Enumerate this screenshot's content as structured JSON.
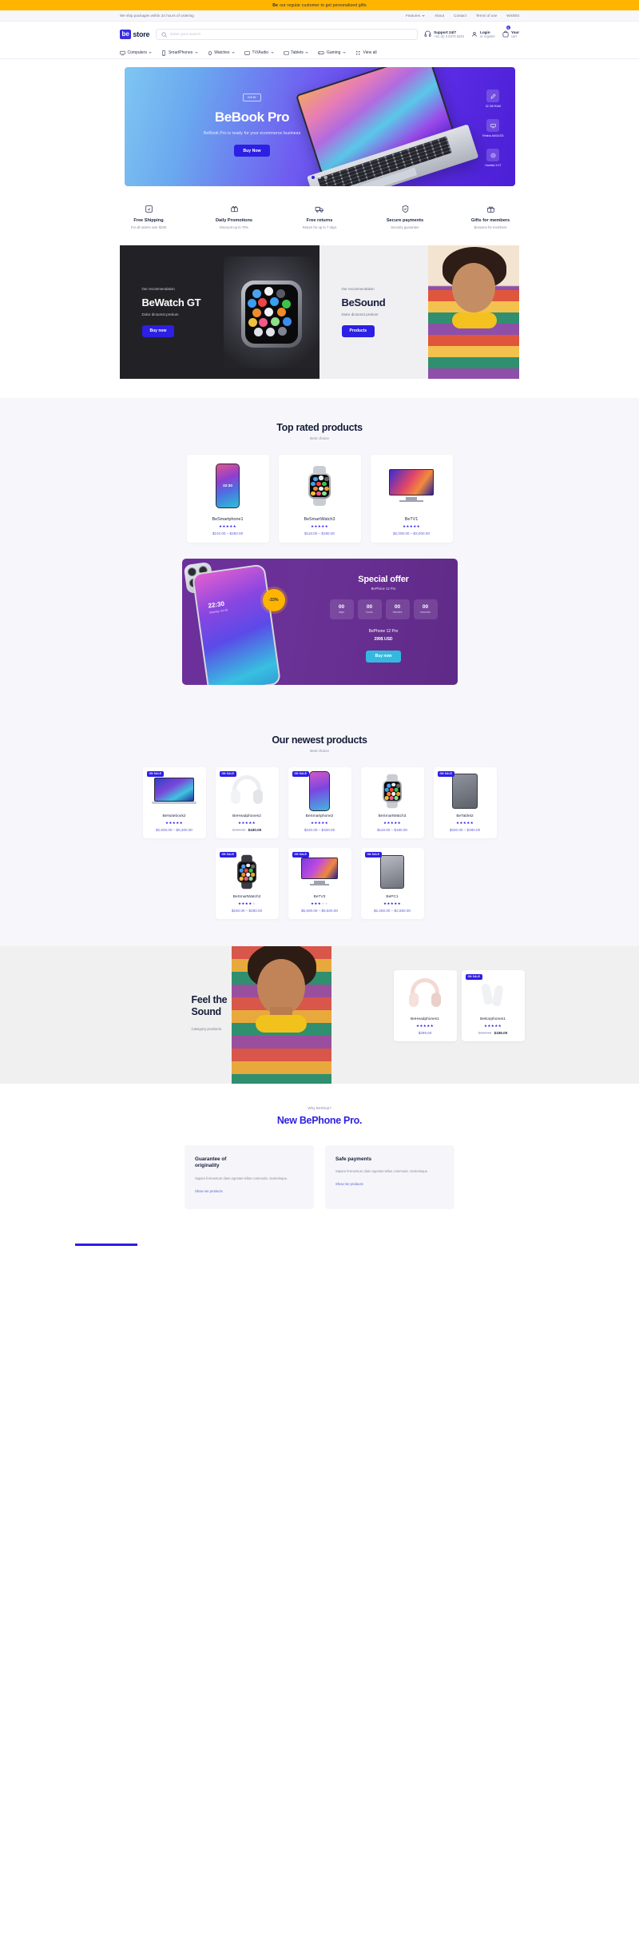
{
  "promo_bar": {
    "bold": "Be",
    "text": "our regular customer to get personalized gifts"
  },
  "util_bar": {
    "shipping_note": "We ship packages within 24 hours of ordering",
    "links": [
      "Features",
      "About",
      "Contact",
      "Terms of use",
      "Wishlist"
    ]
  },
  "header": {
    "logo_mark": "be",
    "logo_text": "store",
    "search_placeholder": "Enter your search",
    "search_value": "",
    "support_title": "Support 24/7",
    "support_phone": "+61 (0) 3 8376 6284",
    "login_title": "Login",
    "login_sub": "or register",
    "cart_title": "Your",
    "cart_sub": "cart",
    "cart_count": "0"
  },
  "categories": [
    {
      "label": "Computers",
      "icon": "monitor-icon"
    },
    {
      "label": "SmartPhones",
      "icon": "phone-icon"
    },
    {
      "label": "Watches",
      "icon": "watch-icon"
    },
    {
      "label": "TV/Audio",
      "icon": "tv-icon"
    },
    {
      "label": "Tablets",
      "icon": "tablet-icon"
    },
    {
      "label": "Gaming",
      "icon": "gamepad-icon"
    },
    {
      "label": "View all",
      "icon": "grid-icon"
    }
  ],
  "hero": {
    "badge": "NEW",
    "title": "BeBook Pro",
    "subtitle": "BeBook Pro is ready for your ecommerce business",
    "cta": "Buy Now",
    "specs": [
      {
        "label": "32 GB RAM",
        "icon": "pen-icon"
      },
      {
        "label": "Retina AMOLED",
        "icon": "display-icon"
      },
      {
        "label": "Hardisk 3.07",
        "icon": "disk-icon"
      }
    ],
    "slides": 3,
    "active_slide": 1
  },
  "features": [
    {
      "icon": "box-check-icon",
      "title": "Free Shipping",
      "sub": "For all orders over $200"
    },
    {
      "icon": "gift-tag-icon",
      "title": "Daily Promotions",
      "sub": "Discount up to 70%"
    },
    {
      "icon": "truck-return-icon",
      "title": "Free returns",
      "sub": "Return for up to 7 days"
    },
    {
      "icon": "shield-lock-icon",
      "title": "Secure payments",
      "sub": "Security guarantee"
    },
    {
      "icon": "gift-icon",
      "title": "Gifts for members",
      "sub": "Bonuses for members"
    }
  ],
  "recommendations": [
    {
      "eyebrow": "Our recommendation",
      "title": "BeWatch GT",
      "desc": "Dolor dictumst pretium",
      "cta": "Buy now",
      "theme": "dark"
    },
    {
      "eyebrow": "Our recommendation",
      "title": "BeSound",
      "desc": "Dolor dictumst pretium",
      "cta": "Products",
      "theme": "light"
    }
  ],
  "top_rated": {
    "title": "Top rated products",
    "subtitle": "Best choice",
    "products": [
      {
        "name": "BeSmartphone1",
        "rating": 5,
        "price": "$210.00 – $250.00",
        "thumb": "phone",
        "badge": ""
      },
      {
        "name": "BeSmartWatch3",
        "rating": 5,
        "price": "$118.00 – $180.00",
        "thumb": "watch",
        "badge": ""
      },
      {
        "name": "BeTV1",
        "rating": 5,
        "price": "$2,000.00 – $3,000.00",
        "thumb": "tv",
        "badge": ""
      }
    ]
  },
  "special_offer": {
    "title": "Special offer",
    "subtitle": "BePhone 12 Pro",
    "discount": "-33%",
    "phone_time": "22:30",
    "phone_date": "Saturday, Oct 26",
    "counters": [
      {
        "value": "00",
        "unit": "days"
      },
      {
        "value": "00",
        "unit": "hours"
      },
      {
        "value": "00",
        "unit": "minutes"
      },
      {
        "value": "00",
        "unit": "seconds"
      }
    ],
    "product_name": "BePhone 12 Pro",
    "product_price": "299$ USD",
    "cta": "Buy now"
  },
  "newest": {
    "title": "Our newest products",
    "subtitle": "Best choice",
    "products": [
      {
        "name": "BeNotebook2",
        "rating": 5,
        "price": "$2,500.00 – $5,300.00",
        "old_price": "",
        "thumb": "notebook",
        "badge": "ON SALE"
      },
      {
        "name": "BeHeadphones2",
        "rating": 5,
        "price": "$430.00",
        "old_price": "$450.00",
        "thumb": "headphone",
        "badge": "ON SALE"
      },
      {
        "name": "BeSmartphone2",
        "rating": 5,
        "price": "$220.00 – $320.00",
        "old_price": "",
        "thumb": "phone2",
        "badge": "ON SALE"
      },
      {
        "name": "BeSmartWatch3",
        "rating": 5,
        "price": "$118.00 – $180.00",
        "old_price": "",
        "thumb": "watch",
        "badge": ""
      },
      {
        "name": "BeTablet2",
        "rating": 5,
        "price": "$320.00 – $480.00",
        "old_price": "",
        "thumb": "tablet",
        "badge": "ON SALE"
      },
      {
        "name": "BeSmartWatch2",
        "rating": 4,
        "price": "$150.00 – $250.00",
        "old_price": "",
        "thumb": "watch",
        "badge": "ON SALE"
      },
      {
        "name": "BeTV3",
        "rating": 3,
        "price": "$5,500.00 – $6,500.00",
        "old_price": "",
        "thumb": "tv",
        "badge": "ON SALE"
      },
      {
        "name": "BePC1",
        "rating": 5,
        "price": "$2,250.00 – $2,550.00",
        "old_price": "",
        "thumb": "tablet",
        "badge": "ON SALE"
      }
    ]
  },
  "feel_sound": {
    "title_line1": "Feel the",
    "title_line2": "Sound",
    "subtitle": "Category products",
    "products": [
      {
        "name": "BeHeadphones1",
        "rating": 5,
        "price": "$299.00",
        "old_price": "",
        "thumb": "headphone",
        "badge": ""
      },
      {
        "name": "BeEarphones1",
        "rating": 5,
        "price": "$155.00",
        "old_price": "$180.00",
        "thumb": "earphone",
        "badge": "ON SALE"
      }
    ]
  },
  "why_shop": {
    "eyebrow": "Why BeShop?",
    "title_plain": "New ",
    "title_accent": "BePhone Pro.",
    "cards": [
      {
        "title_line1": "Guarantee of",
        "title_line2": "originality",
        "body": "Sapien fermentum diam egestas tellus commodo. Scelerisque.",
        "link": "Show me products"
      },
      {
        "title_line1": "Safe payments",
        "title_line2": "",
        "body": "Sapien fermentum diam egestas tellus commodo. Scelerisque.",
        "link": "Show me products"
      }
    ]
  }
}
